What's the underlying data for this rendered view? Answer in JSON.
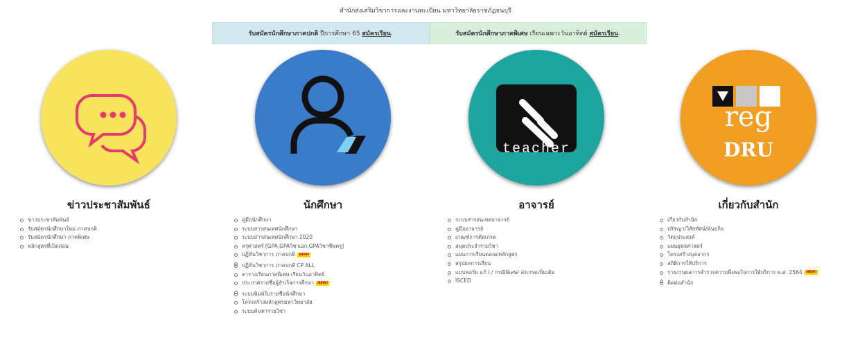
{
  "header": {
    "text": "สำนักส่งเสริมวิชาการและงานทะเบียน มหาวิทยาลัยราชภัฏธนบุรี"
  },
  "banners": [
    {
      "bold": "รับสมัครนักศึกษาภาคปกติ",
      "normal": " ปีการศึกษา 65 ",
      "link": "สมัครเรียน",
      "bg": "#d3e9f0"
    },
    {
      "bold": "รับสมัครนักศึกษาภาคพิเศษ",
      "normal": " เรียนเฉพาะวันอาทิตย์ ",
      "link": "สมัครเรียน",
      "bg": "#d8efdc"
    }
  ],
  "new_badge": "NEW!",
  "columns": [
    {
      "title": "ข่าวประชาสัมพันธ์",
      "icon": "chat-bubbles-icon",
      "color": "#f8e45c",
      "items": [
        {
          "label": "ข่าวประชาสัมพันธ์",
          "new": false
        },
        {
          "label": "รับสมัครนักศึกษาใหม่ ภาคปกติ",
          "new": false
        },
        {
          "label": "รับสมัครนักศึกษา ภาคพิเศษ",
          "new": false
        },
        {
          "label": "หลักสูตรที่เปิดสอน",
          "new": false
        }
      ]
    },
    {
      "title": "นักศึกษา",
      "icon": "student-icon",
      "color": "#3a7cc9",
      "items": [
        {
          "label": "คู่มือนักศึกษา",
          "new": false
        },
        {
          "label": "ระบบสารสนเทศนักศึกษา",
          "new": false
        },
        {
          "label": "ระบบสารสนเทศนักศึกษา 2020",
          "new": false
        },
        {
          "label": "ครุศาสตร์ [GPA,GPAวิชาเอก,GPAวิชาชีพครู]",
          "new": false
        },
        {
          "label": "ปฏิทินวิชาการ ภาคปกติ",
          "new": true
        },
        {
          "label": "ปฏิทินวิชาการ ภาคปกติ CP ALL",
          "new": false
        },
        {
          "label": "ตารางเรียนภาคพิเศษ เรียนวันอาทิตย์",
          "new": false
        },
        {
          "label": "ประกาศรายชื่อผู้สำเร็จการศึกษา",
          "new": true
        },
        {
          "label": "ระบบพิมพ์ใบรายชื่อนักศึกษา",
          "new": false
        },
        {
          "label": "โครงสร้างหลักสูตรมหาวิทยาลัย",
          "new": false
        },
        {
          "label": "ระบบค้นหารายวิชา",
          "new": false
        }
      ]
    },
    {
      "title": "อาจารย์",
      "icon": "teacher-icon",
      "color": "#1fa5a0",
      "logo_text": "teacher",
      "items": [
        {
          "label": "ระบบสารสนเทศอาจารย์",
          "new": false
        },
        {
          "label": "คู่มืออาจารย์",
          "new": false
        },
        {
          "label": "เกณฑ์การตัดเกรด",
          "new": false
        },
        {
          "label": "สมุดประจำรายวิชา",
          "new": false
        },
        {
          "label": "แผนการเรียนตลอดหลักสูตร",
          "new": false
        },
        {
          "label": "สรุปผลการเรียน",
          "new": false
        },
        {
          "label": "แบบฟอร์ม แก้ I / กรณีพิเศษ/ ส่งเกรดเพิ่มเติม",
          "new": false
        },
        {
          "label": "ISCED",
          "new": false
        }
      ]
    },
    {
      "title": "เกี่ยวกับสำนัก",
      "icon": "reg-dru-icon",
      "color": "#f29e23",
      "logo_text": "reg",
      "logo_sub": "DRU",
      "items": [
        {
          "label": "เกี่ยวกับสำนัก",
          "new": false
        },
        {
          "label": "ปรัชญา/วิสัยทัศน์/พันธกิจ",
          "new": false
        },
        {
          "label": "วัตถุประสงค์",
          "new": false
        },
        {
          "label": "แผนยุทธศาสตร์",
          "new": false
        },
        {
          "label": "โครงสร้างบุคลากร",
          "new": false
        },
        {
          "label": "สถิติการให้บริการ",
          "new": false
        },
        {
          "label": "รายงานผลการสำรวจความพึงพอใจการให้บริการ พ.ศ. 2564",
          "new": true
        },
        {
          "label": "ติดต่อสำนัก",
          "new": false
        }
      ]
    }
  ]
}
